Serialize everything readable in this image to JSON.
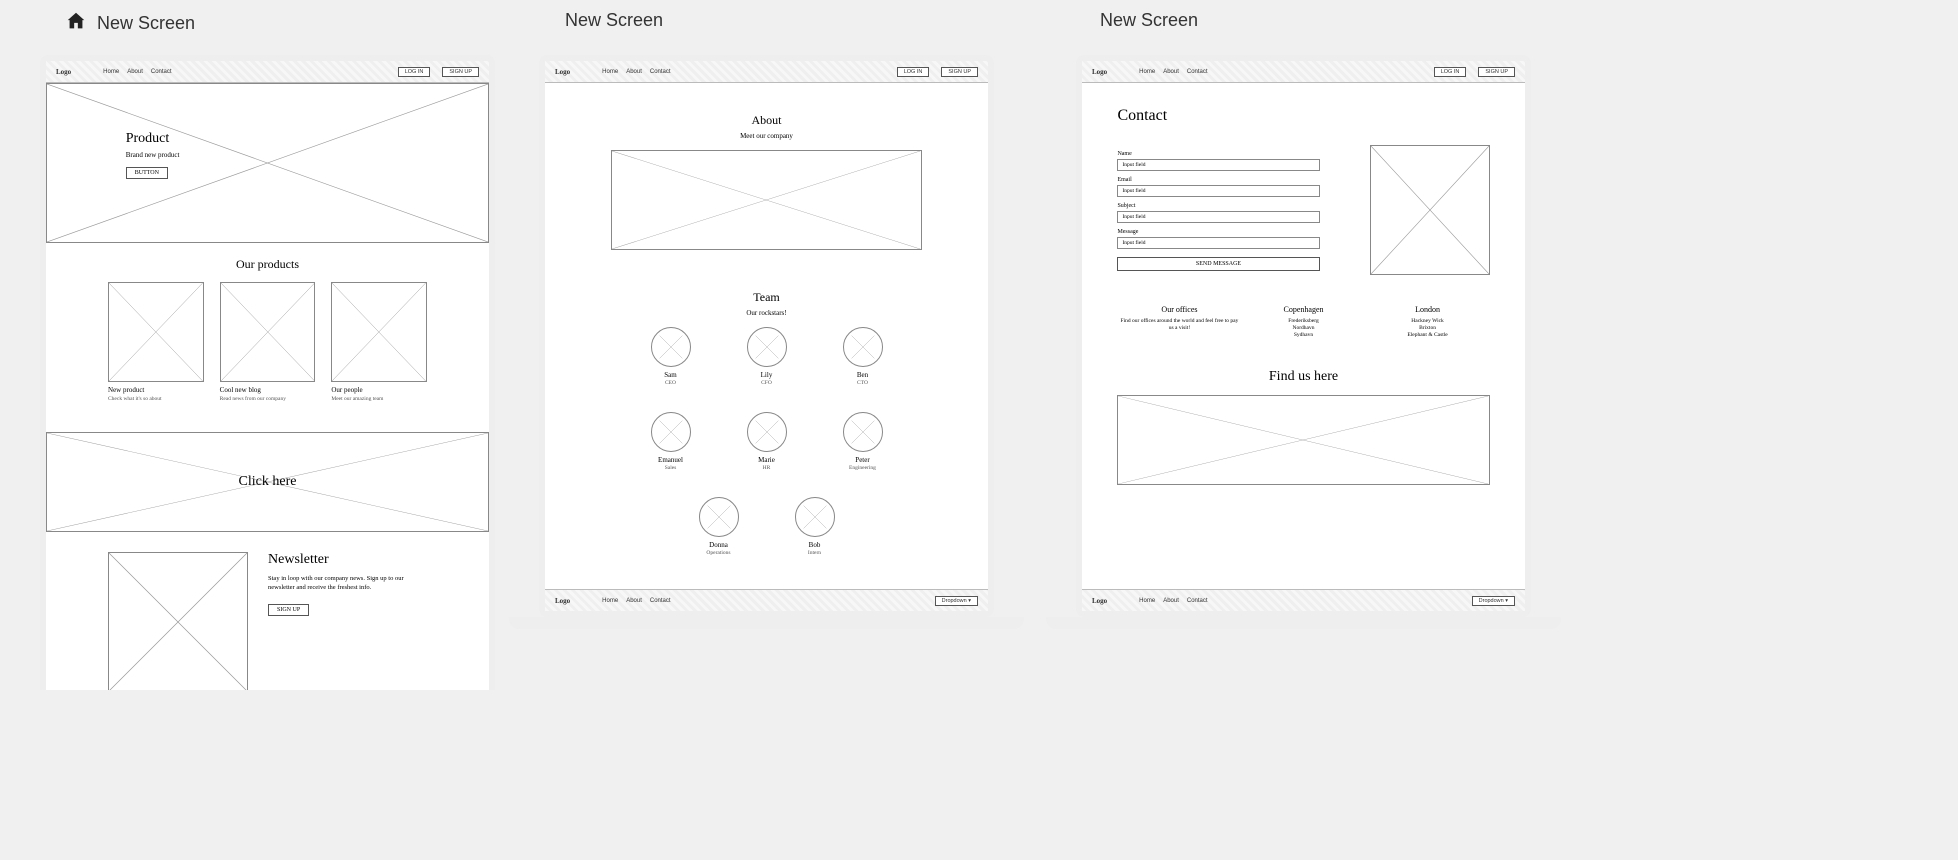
{
  "labels": {
    "screen1": "New Screen",
    "screen2": "New Screen",
    "screen3": "New Screen"
  },
  "header": {
    "logo": "Logo",
    "nav": [
      "Home",
      "About",
      "Contact"
    ],
    "login": "LOG IN",
    "signup": "SIGN UP"
  },
  "footer": {
    "logo": "Logo",
    "nav": [
      "Home",
      "About",
      "Contact"
    ],
    "dropdown": "Dropdown ▾"
  },
  "screen1": {
    "hero": {
      "title": "Product",
      "subtitle": "Brand new product",
      "button": "BUTTON"
    },
    "products": {
      "heading": "Our products",
      "cards": [
        {
          "title": "New product",
          "sub": "Check what it's so about"
        },
        {
          "title": "Cool new blog",
          "sub": "Read news from our company"
        },
        {
          "title": "Our people",
          "sub": "Meet our amazing team"
        }
      ]
    },
    "banner": "Click here",
    "newsletter": {
      "title": "Newsletter",
      "body": "Stay in loop with our company news. Sign up to our newsletter and receive the freshest info.",
      "button": "SIGN UP"
    }
  },
  "screen2": {
    "about": {
      "title": "About",
      "sub": "Meet our company"
    },
    "team": {
      "title": "Team",
      "sub": "Our rockstars!",
      "members": [
        {
          "name": "Sam",
          "role": "CEO"
        },
        {
          "name": "Lily",
          "role": "CFO"
        },
        {
          "name": "Ben",
          "role": "CTO"
        },
        {
          "name": "Emanuel",
          "role": "Sales"
        },
        {
          "name": "Marie",
          "role": "HR"
        },
        {
          "name": "Peter",
          "role": "Engineering"
        },
        {
          "name": "Donna",
          "role": "Operations"
        },
        {
          "name": "Bob",
          "role": "Intern"
        }
      ]
    }
  },
  "screen3": {
    "contact": {
      "title": "Contact",
      "fields": [
        {
          "label": "Name",
          "placeholder": "Input field"
        },
        {
          "label": "Email",
          "placeholder": "Input field"
        },
        {
          "label": "Subject",
          "placeholder": "Input field"
        },
        {
          "label": "Message",
          "placeholder": "Input field"
        }
      ],
      "send": "SEND MESSAGE"
    },
    "offices": [
      {
        "title": "Our offices",
        "body": "Find our offices around the world and feel free to pay us a visit!"
      },
      {
        "title": "Copenhagen",
        "body": "Frederiksberg\nNordhavn\nSydhavn"
      },
      {
        "title": "London",
        "body": "Hackney Wick\nBrixton\nElephant & Castle"
      }
    ],
    "find": "Find us here"
  }
}
